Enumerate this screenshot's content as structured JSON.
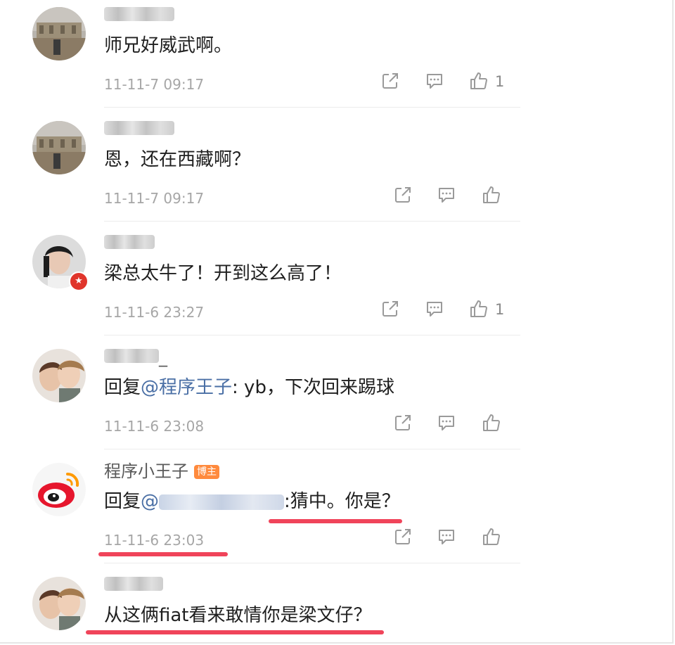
{
  "comments": [
    {
      "name": "",
      "text": "师兄好威武啊。",
      "time": "11-11-7 09:17",
      "likes": "1"
    },
    {
      "name": "",
      "text": "恩，还在西藏啊？",
      "time": "11-11-7 09:17",
      "likes": ""
    },
    {
      "name": "",
      "text": "梁总太牛了！开到这么高了！",
      "time": "11-11-6 23:27",
      "likes": "1"
    },
    {
      "name": "",
      "text_prefix": "回复",
      "mention": "@程序王子",
      "text_suffix": ": yb，下次回来踢球",
      "time": "11-11-6 23:08",
      "likes": ""
    },
    {
      "name": "程序小王子",
      "badge": "博主",
      "text_prefix": "回复",
      "mention": "@",
      "text_suffix": ":猜中。你是？",
      "time": "11-11-6 23:03",
      "likes": ""
    },
    {
      "name": "",
      "text": "从这俩fiat看来敢情你是梁文仔？"
    }
  ],
  "icons": {
    "share": "share-icon",
    "comment": "comment-icon",
    "like": "thumbs-up-icon"
  },
  "colors": {
    "mention": "#4a6fa5",
    "underline": "#f0445a",
    "badge": "#ff8a3d"
  }
}
